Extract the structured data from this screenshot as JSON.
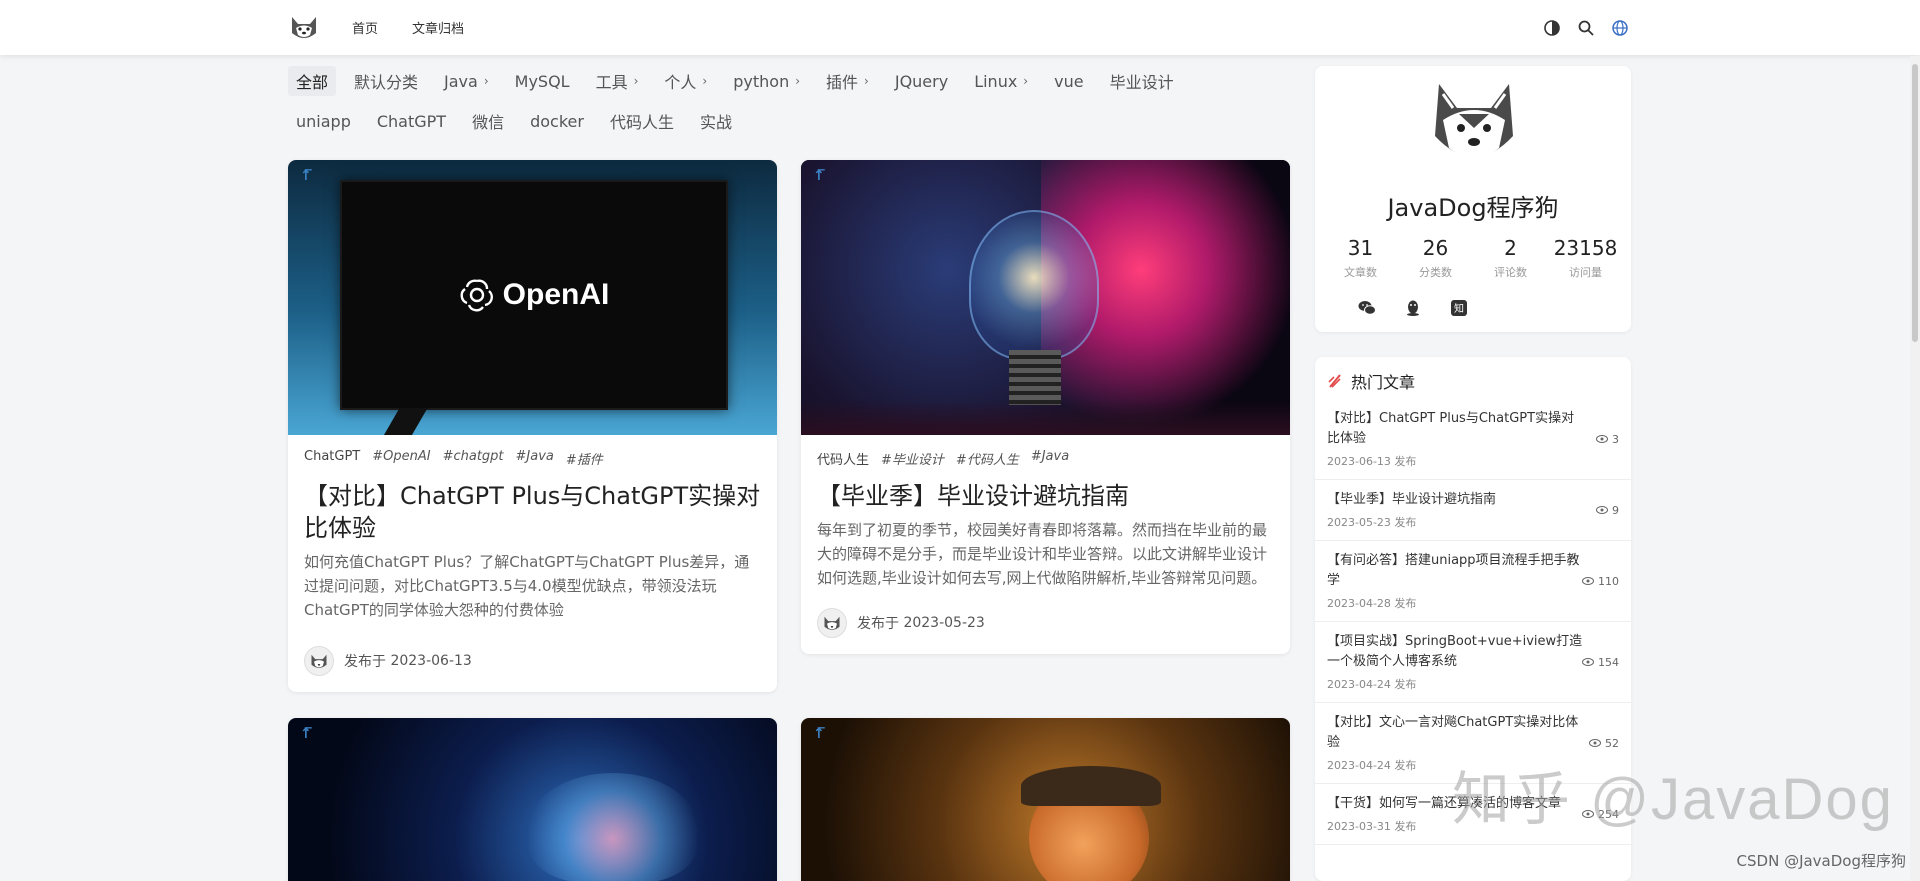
{
  "nav": {
    "home": "首页",
    "archive": "文章归档"
  },
  "categories": {
    "row1": [
      {
        "label": "全部",
        "active": true,
        "chevron": false
      },
      {
        "label": "默认分类",
        "chevron": false
      },
      {
        "label": "Java",
        "chevron": true
      },
      {
        "label": "MySQL",
        "chevron": false
      },
      {
        "label": "工具",
        "chevron": true
      },
      {
        "label": "个人",
        "chevron": true
      },
      {
        "label": "python",
        "chevron": true
      },
      {
        "label": "插件",
        "chevron": true
      },
      {
        "label": "JQuery",
        "chevron": false
      },
      {
        "label": "Linux",
        "chevron": true
      },
      {
        "label": "vue",
        "chevron": false
      },
      {
        "label": "毕业设计",
        "chevron": false
      }
    ],
    "row2": [
      {
        "label": "uniapp"
      },
      {
        "label": "ChatGPT"
      },
      {
        "label": "微信"
      },
      {
        "label": "docker"
      },
      {
        "label": "代码人生"
      },
      {
        "label": "实战"
      }
    ]
  },
  "posts": [
    {
      "category": "ChatGPT",
      "tags": [
        "#OpenAI",
        "#chatgpt",
        "#Java",
        "#插件"
      ],
      "title": "【对比】ChatGPT Plus与ChatGPT实操对比体验",
      "excerpt": "如何充值ChatGPT Plus？了解ChatGPT与ChatGPT Plus差异，通过提问问题，对比ChatGPT3.5与4.0模型优缺点，带领没法玩ChatGPT的同学体验大怨种的付费体验",
      "date_prefix": "发布于",
      "date": "2023-06-13",
      "image_text": "OpenAI"
    },
    {
      "category": "代码人生",
      "tags": [
        "#毕业设计",
        "#代码人生",
        "#Java"
      ],
      "title": "【毕业季】毕业设计避坑指南",
      "excerpt": "每年到了初夏的季节，校园美好青春即将落幕。然而挡在毕业前的最大的障碍不是分手，而是毕业设计和毕业答辩。以此文讲解毕业设计如何选题,毕业设计如何去写,网上代做陷阱解析,毕业答辩常见问题。",
      "date_prefix": "发布于",
      "date": "2023-05-23"
    }
  ],
  "profile": {
    "name": "JavaDog程序狗",
    "stats": [
      {
        "value": "31",
        "label": "文章数"
      },
      {
        "value": "26",
        "label": "分类数"
      },
      {
        "value": "2",
        "label": "评论数"
      },
      {
        "value": "23158",
        "label": "访问量"
      }
    ]
  },
  "hot": {
    "title": "热门文章",
    "items": [
      {
        "title": "【对比】ChatGPT Plus与ChatGPT实操对比体验",
        "date": "2023-06-13 发布",
        "views": "3"
      },
      {
        "title": "【毕业季】毕业设计避坑指南",
        "date": "2023-05-23 发布",
        "views": "9"
      },
      {
        "title": "【有问必答】搭建uniapp项目流程手把手教学",
        "date": "2023-04-28 发布",
        "views": "110"
      },
      {
        "title": "【项目实战】SpringBoot+vue+iview打造一个极简个人博客系统",
        "date": "2023-04-24 发布",
        "views": "154"
      },
      {
        "title": "【对比】文心一言对飚ChatGPT实操对比体验",
        "date": "2023-04-24 发布",
        "views": "52"
      },
      {
        "title": "【干货】如何写一篇还算凑活的博客文章",
        "date": "2023-03-31 发布",
        "views": "254"
      }
    ]
  },
  "watermark": "知乎 @JavaDog",
  "csdn": "CSDN @JavaDog程序狗"
}
